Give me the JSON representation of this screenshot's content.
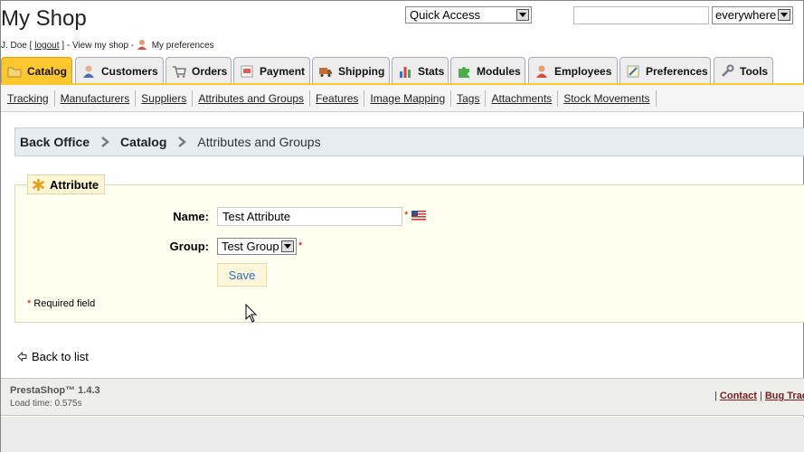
{
  "header": {
    "shop_title": "My Shop",
    "user_name": "J. Doe [",
    "logout": "logout",
    "after_logout": "] - View my shop -",
    "preferences": "My preferences",
    "quick_access": "Quick Access",
    "search_placeholder": "",
    "search_scope": "everywhere"
  },
  "tabs": [
    {
      "label": "Catalog",
      "icon": "folder-icon",
      "active": true
    },
    {
      "label": "Customers",
      "icon": "customer-icon"
    },
    {
      "label": "Orders",
      "icon": "cart-icon"
    },
    {
      "label": "Payment",
      "icon": "payment-icon"
    },
    {
      "label": "Shipping",
      "icon": "truck-icon"
    },
    {
      "label": "Stats",
      "icon": "chart-icon"
    },
    {
      "label": "Modules",
      "icon": "puzzle-icon"
    },
    {
      "label": "Employees",
      "icon": "employee-icon"
    },
    {
      "label": "Preferences",
      "icon": "preferences-icon"
    },
    {
      "label": "Tools",
      "icon": "wrench-icon"
    }
  ],
  "subnav": [
    "Tracking",
    "Manufacturers",
    "Suppliers",
    "Attributes and Groups",
    "Features",
    "Image Mapping",
    "Tags",
    "Attachments",
    "Stock Movements"
  ],
  "breadcrumb": {
    "items": [
      "Back Office",
      "Catalog"
    ],
    "current": "Attributes and Groups"
  },
  "form": {
    "legend": "Attribute",
    "name_label": "Name:",
    "name_value": "Test Attribute",
    "group_label": "Group:",
    "group_value": "Test Group",
    "required_mark": "*",
    "save_label": "Save",
    "required_note": "Required field"
  },
  "back_link": "Back to list",
  "footer": {
    "version": "PrestaShop™ 1.4.3",
    "load_time": "Load time: 0.575s",
    "sep": "|",
    "contact": "Contact",
    "bug_tracker": "Bug Tracker"
  },
  "colors": {
    "active_tab": "#ffc72e",
    "fieldset_bg": "#fffff0",
    "breadcrumb_bg": "#e6ecef",
    "required": "#cc0000",
    "save_text": "#2a6fb5"
  }
}
